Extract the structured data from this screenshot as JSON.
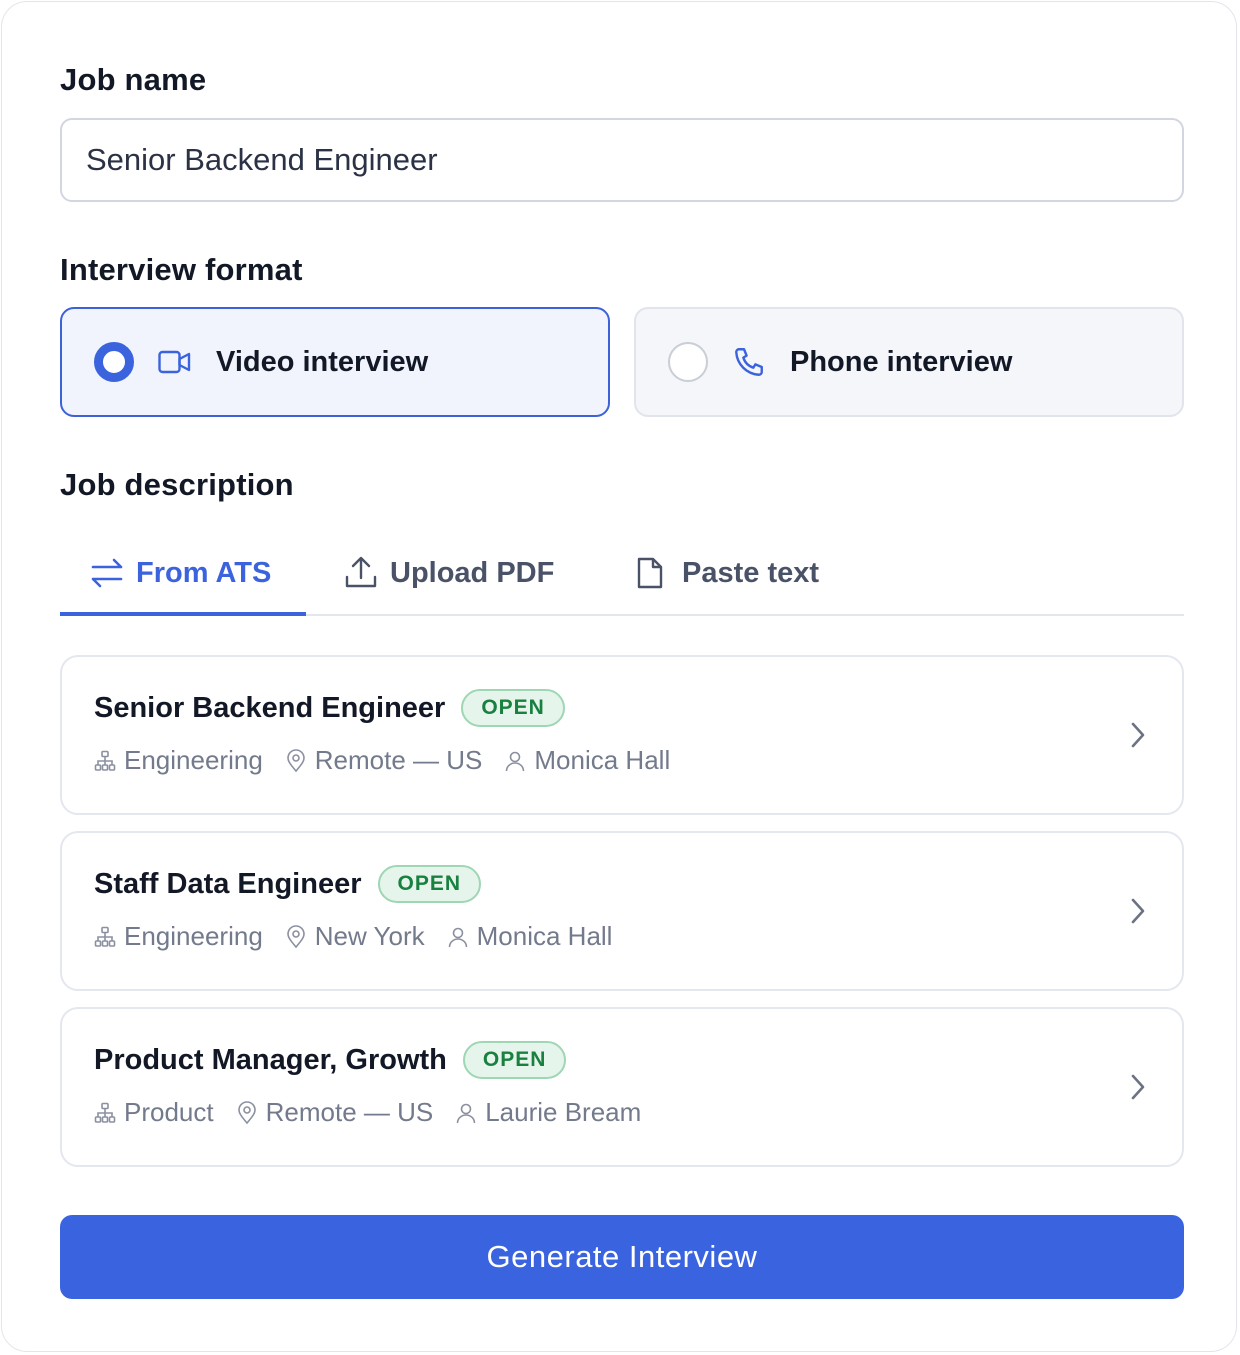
{
  "job_name": {
    "label": "Job name",
    "value": "Senior Backend Engineer"
  },
  "interview_format": {
    "label": "Interview format",
    "options": [
      {
        "label": "Video interview",
        "icon": "video-camera-icon",
        "selected": true
      },
      {
        "label": "Phone interview",
        "icon": "phone-icon",
        "selected": false
      }
    ]
  },
  "job_description": {
    "label": "Job description",
    "tabs": [
      {
        "label": "From ATS",
        "icon": "swap-arrows-icon",
        "active": true
      },
      {
        "label": "Upload PDF",
        "icon": "upload-icon",
        "active": false
      },
      {
        "label": "Paste text",
        "icon": "document-icon",
        "active": false
      }
    ],
    "jobs": [
      {
        "title": "Senior Backend Engineer",
        "status": "OPEN",
        "department": "Engineering",
        "location": "Remote — US",
        "owner": "Monica Hall"
      },
      {
        "title": "Staff Data Engineer",
        "status": "OPEN",
        "department": "Engineering",
        "location": "New York",
        "owner": "Monica Hall"
      },
      {
        "title": "Product Manager, Growth",
        "status": "OPEN",
        "department": "Product",
        "location": "Remote — US",
        "owner": "Laurie Bream"
      }
    ]
  },
  "generate_button": {
    "label": "Generate Interview"
  },
  "colors": {
    "accent": "#3b63dd",
    "badge_text": "#19803f",
    "badge_bg": "#e6f5ec"
  }
}
